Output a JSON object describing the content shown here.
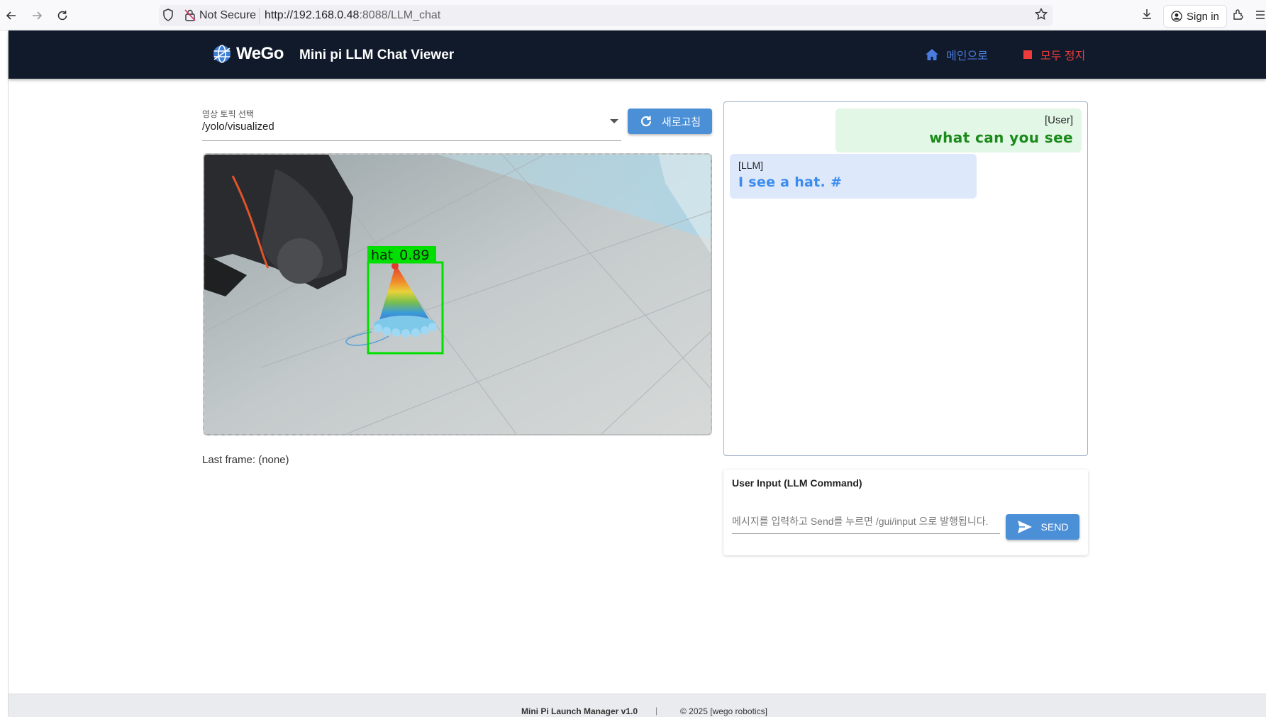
{
  "browser": {
    "not_secure": "Not Secure",
    "url_host": "http://192.168.0.48",
    "url_rest": ":8088/LLM_chat",
    "sign_in": "Sign in"
  },
  "header": {
    "logo_text": "WeGo",
    "title": "Mini pi LLM Chat Viewer",
    "home_label": "메인으로",
    "stop_label": "모두 정지",
    "home_color": "#4a7ce0",
    "stop_color": "#ef3b3b"
  },
  "topic": {
    "label": "영상 토픽 선택",
    "value": "/yolo/visualized",
    "refresh_label": "새로고침"
  },
  "video": {
    "detection_label": "hat",
    "detection_score": "0.89",
    "box_color": "#00e000"
  },
  "last_frame": "Last frame: (none)",
  "chat": {
    "messages": [
      {
        "role": "[User]",
        "text": "what can you see"
      },
      {
        "role": "[LLM]",
        "text": "I see a hat. #"
      }
    ]
  },
  "input": {
    "title": "User Input (LLM Command)",
    "placeholder": "메시지를 입력하고 Send를 누르면 /gui/input 으로 발행됩니다.",
    "send_label": "SEND"
  },
  "footer": {
    "version": "Mini Pi Launch Manager v1.0",
    "divider": "|",
    "copyright": "© 2025 [wego robotics]"
  }
}
